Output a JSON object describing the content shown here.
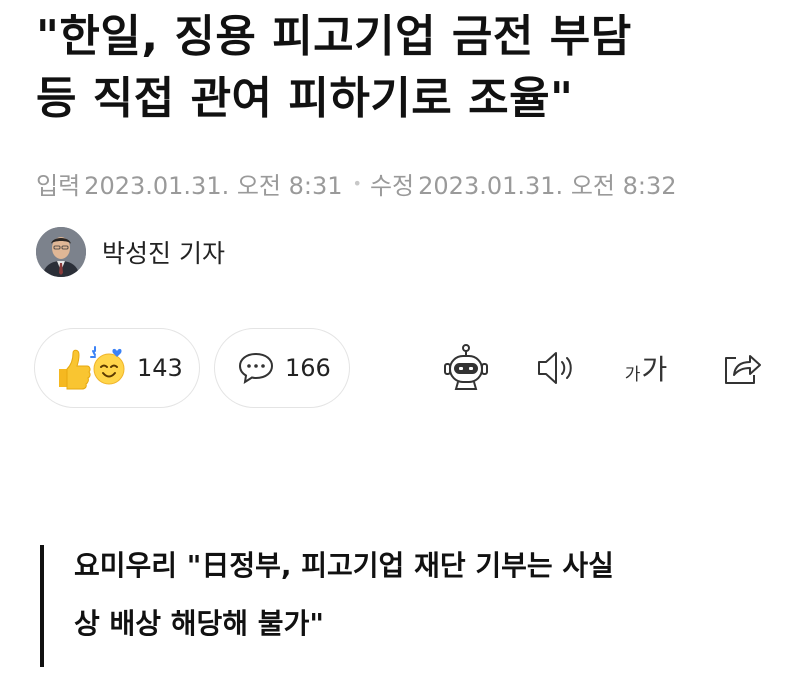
{
  "article": {
    "headline_line1": "\"한일, 징용 피고기업 금전 부담",
    "headline_line2": "등 직접 관여 피하기로 조율\"",
    "input_label": "입력",
    "input_time": "2023.01.31. 오전 8:31",
    "edit_label": "수정",
    "edit_time": "2023.01.31. 오전 8:32",
    "reporter": "박성진 기자",
    "subheading_line1": "요미우리 \"日정부, 피고기업 재단 기부는 사실",
    "subheading_line2": "상 배상 해당해 불가\""
  },
  "actions": {
    "reaction_count": "143",
    "comment_count": "166",
    "font_small": "가",
    "font_large": "가"
  },
  "icons": {
    "reaction": "thumbs-up-smile-icon",
    "comment": "speech-bubble-icon",
    "summary": "robot-icon",
    "listen": "speaker-icon",
    "font_size": "font-size-icon",
    "share": "share-icon"
  },
  "colors": {
    "meta_text": "#9a9a9a",
    "thumb_yellow": "#f9c531",
    "face_yellow": "#ffd54a",
    "sparkle_blue": "#3b82f6"
  }
}
